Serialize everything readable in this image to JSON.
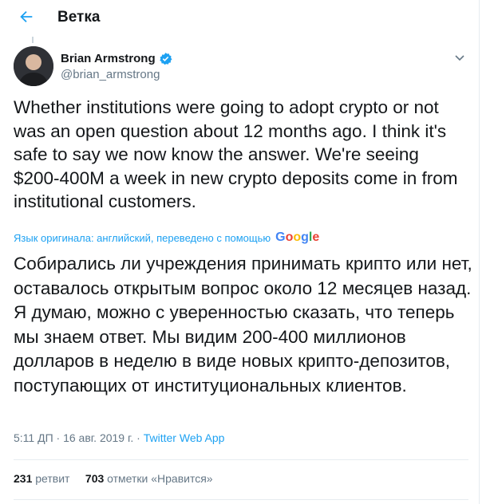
{
  "header": {
    "title": "Ветка",
    "back_icon": "arrow-left-icon"
  },
  "tweet": {
    "author_name": "Brian Armstrong",
    "author_handle": "@brian_armstrong",
    "verified_icon": "verified-badge-icon",
    "menu_icon": "chevron-down-icon",
    "text_original": "Whether institutions were going to adopt crypto or not was an open question about 12 months ago. I think it's safe to say we now know the answer. We're seeing $200-400M a week in new crypto deposits come in from institutional customers.",
    "translation_note": "Язык оригинала: английский, переведено с помощью",
    "translation_provider": "Google",
    "text_translated": "Собирались ли учреждения принимать крипто или нет, оставалось открытым вопрос около 12 месяцев назад. Я думаю, можно с уверенностью сказать, что теперь мы знаем ответ. Мы видим 200-400 миллионов долларов в неделю в виде новых крипто-депозитов, поступающих от институциональных клиентов.",
    "timestamp": "5:11 ДП · 16 авг. 2019 г.",
    "separator": " · ",
    "source_app": "Twitter Web App",
    "retweets_count": "231",
    "retweets_label": "ретвит",
    "likes_count": "703",
    "likes_label": "отметки «Нравится»"
  },
  "colors": {
    "accent": "#1da1f2",
    "text": "#14171a",
    "secondary": "#657786",
    "divider": "#e6ecf0"
  }
}
